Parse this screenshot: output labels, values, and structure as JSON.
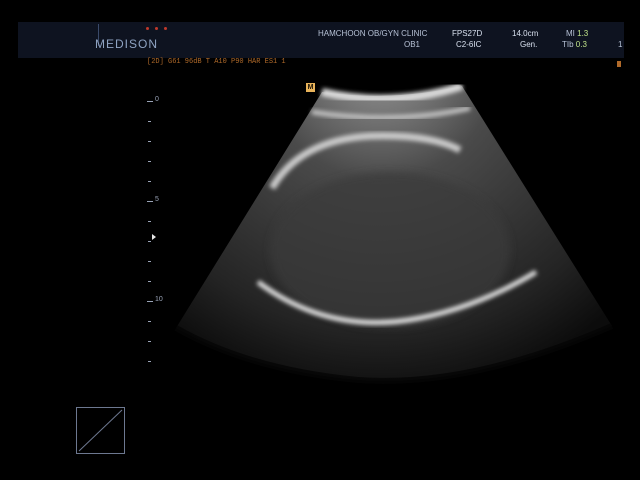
{
  "header": {
    "logo": "MEDISON",
    "clinic": "HAMCHOON OB/GYN CLINIC",
    "preset": "OB1",
    "fps": "FPS27D",
    "probe": "C2-6IC",
    "depth": "14.0cm",
    "mode": "Gen.",
    "mi_label": "MI",
    "mi_value": "1.3",
    "tib_label": "TIb",
    "tib_value": "0.3",
    "right_digit": "1"
  },
  "params_line": "[2D] G61 96dB T A10 P90 HAR ES1 1",
  "marker_label": "M",
  "depth_scale": {
    "labels": [
      "0",
      "5",
      "10"
    ]
  },
  "colors": {
    "header_bg": "#0e1320",
    "logo": "#8fa3c2",
    "param_text": "#b06a2a",
    "mi_value": "#bfe38a",
    "marker": "#e8b35a"
  }
}
